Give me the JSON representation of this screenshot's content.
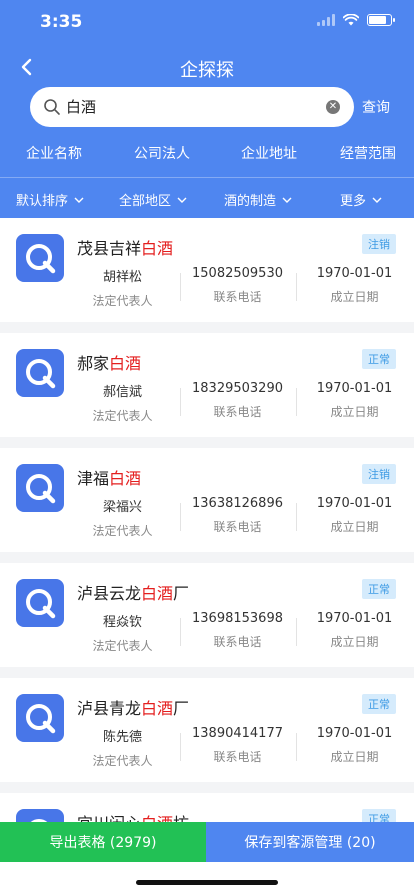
{
  "status": {
    "time": "3:35"
  },
  "nav": {
    "title": "企探探"
  },
  "search": {
    "value": "白酒",
    "query_label": "查询",
    "tabs": [
      "企业名称",
      "公司法人",
      "企业地址",
      "经营范围"
    ]
  },
  "filters": [
    {
      "label": "默认排序"
    },
    {
      "label": "全部地区"
    },
    {
      "label": "酒的制造"
    },
    {
      "label": "更多"
    }
  ],
  "companies": [
    {
      "name_prefix": "茂县吉祥",
      "name_highlight": "白酒",
      "name_suffix": "",
      "status": "注销",
      "legal_rep": "胡祥松",
      "phone": "15082509530",
      "founded": "1970-01-01"
    },
    {
      "name_prefix": "郝家",
      "name_highlight": "白酒",
      "name_suffix": "",
      "status": "正常",
      "legal_rep": "郝信斌",
      "phone": "18329503290",
      "founded": "1970-01-01"
    },
    {
      "name_prefix": "津福",
      "name_highlight": "白酒",
      "name_suffix": "",
      "status": "注销",
      "legal_rep": "梁福兴",
      "phone": "13638126896",
      "founded": "1970-01-01"
    },
    {
      "name_prefix": "泸县云龙",
      "name_highlight": "白酒",
      "name_suffix": "厂",
      "status": "正常",
      "legal_rep": "程焱钦",
      "phone": "13698153698",
      "founded": "1970-01-01"
    },
    {
      "name_prefix": "泸县青龙",
      "name_highlight": "白酒",
      "name_suffix": "厂",
      "status": "正常",
      "legal_rep": "陈先德",
      "phone": "13890414177",
      "founded": "1970-01-01"
    },
    {
      "name_prefix": "宜川闲心",
      "name_highlight": "白酒",
      "name_suffix": "坊",
      "status": "正常"
    }
  ],
  "labels": {
    "legal_rep": "法定代表人",
    "phone": "联系电话",
    "founded": "成立日期"
  },
  "actions": {
    "export_label": "导出表格 (2979)",
    "save_label": "保存到客源管理 (20)"
  },
  "colors": {
    "primary": "#4f86f0",
    "highlight": "#e41f1f",
    "export": "#22c155"
  }
}
